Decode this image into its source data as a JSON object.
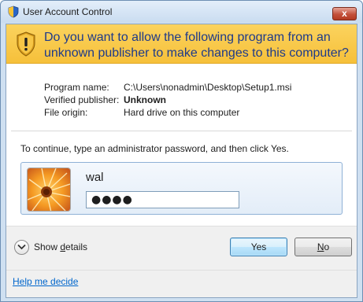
{
  "window": {
    "title": "User Account Control",
    "close_label": "x"
  },
  "banner": {
    "message": "Do you want to allow the following program from an unknown publisher to make changes to this computer?"
  },
  "details": {
    "program_name_label": "Program name:",
    "program_name_value": "C:\\Users\\nonadmin\\Desktop\\Setup1.msi",
    "publisher_label": "Verified publisher:",
    "publisher_value": "Unknown",
    "origin_label": "File origin:",
    "origin_value": "Hard drive on this computer"
  },
  "credentials": {
    "instruction": "To continue, type an administrator password, and then click Yes.",
    "username": "wal",
    "password_masked": "●●●●"
  },
  "footer": {
    "show_details_pre": "Show ",
    "show_details_underlined": "d",
    "show_details_post": "etails",
    "yes_label": "Yes",
    "no_label_underlined": "N",
    "no_label_rest": "o",
    "help_link": "Help me decide"
  },
  "colors": {
    "banner": "#f6c03a",
    "banner_text": "#1e3a8a",
    "link": "#0066cc"
  }
}
